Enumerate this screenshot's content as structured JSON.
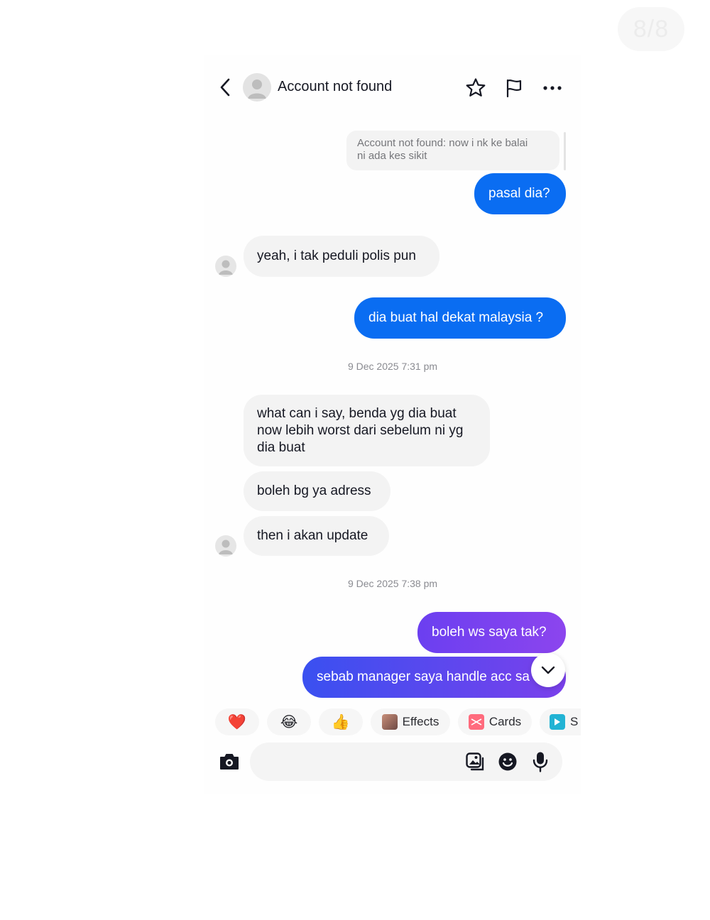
{
  "page_counter": "8/8",
  "header": {
    "title": "Account not found",
    "back_icon": "chevron-left-icon",
    "star_icon": "star-icon",
    "flag_icon": "flag-icon",
    "more_icon": "more-dots-icon"
  },
  "reply_quote": {
    "line1": "Account not found: now i nk ke balai",
    "line2": "ni ada kes sikit"
  },
  "messages": [
    {
      "side": "out",
      "text": "pasal dia?"
    },
    {
      "side": "in",
      "text": "yeah, i tak peduli polis pun"
    },
    {
      "side": "out",
      "text": "dia buat hal dekat malaysia ?"
    },
    {
      "side": "in",
      "lines": [
        "what can i say, benda yg dia buat",
        "now lebih worst dari sebelum ni yg",
        "dia buat"
      ]
    },
    {
      "side": "in",
      "text": "boleh bg ya adress"
    },
    {
      "side": "in",
      "text": "then i akan update"
    },
    {
      "side": "out",
      "text": "boleh ws saya tak?"
    },
    {
      "side": "out",
      "text": "sebab manager saya handle acc sa"
    }
  ],
  "timestamps": [
    "9 Dec 2025 7:31 pm",
    "9 Dec 2025 7:38 pm"
  ],
  "quick_reactions": [
    {
      "icon": "heart-icon",
      "glyph": "❤️"
    },
    {
      "icon": "laughing-emoji-icon",
      "glyph": "😂"
    },
    {
      "icon": "thumbs-up-icon",
      "glyph": "👍"
    }
  ],
  "chips": {
    "effects": "Effects",
    "cards": "Cards",
    "third": "S"
  },
  "composer": {
    "placeholder": "",
    "camera_icon": "camera-icon",
    "gallery_icon": "gallery-icon",
    "emoji_icon": "emoji-icon",
    "mic_icon": "microphone-icon"
  },
  "colors": {
    "outgoing_blue": "#0a6df2",
    "outgoing_purple": "#7a40ec",
    "incoming_bg": "#f3f3f3"
  }
}
